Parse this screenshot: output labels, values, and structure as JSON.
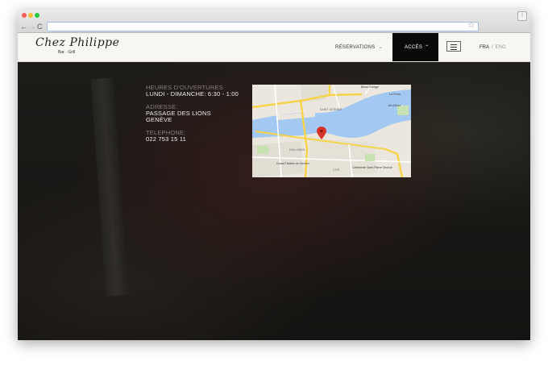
{
  "browser": {
    "address_url": "",
    "profile_glyph": "↑",
    "back_glyph": "←",
    "forward_glyph": "→",
    "reload_glyph": "C",
    "star_glyph": "☆"
  },
  "site": {
    "logo_script": "Chez Philippe",
    "logo_sub": "Bar · Grill",
    "nav": {
      "reservations": "RÉSERVATIONS",
      "acces": "ACCÈS",
      "lang_active": "FRA",
      "lang_separator": "/",
      "lang_inactive": "ENG"
    }
  },
  "info": {
    "hours_label": "HEURES D'OUVERTURES",
    "hours_value": "LUNDI - DIMANCHE: 6:30 - 1:00",
    "address_label": "ADRESSE:",
    "address_line1": "PASSAGE DES LIONS",
    "address_line2": "GENÈVE",
    "phone_label": "TELEPHONE:",
    "phone_value": "022 753 15 11"
  },
  "map": {
    "labels": {
      "beau_rivage": "Beau-Rivage",
      "la_perle": "La Perle",
      "jet_deau": "Jet d'Eau",
      "saint_gervais": "SAINT-GERVAIS",
      "grand_theatre": "Grand Théâtre de Genève",
      "cathedrale": "Cathédrale Saint-Pierre Genève",
      "hollande": "HOLLANDE",
      "cite": "CITÉ"
    }
  },
  "colors": {
    "header_bg": "#f7f6f3",
    "active_nav_bg": "#0a0a0a",
    "page_bg": "#1b1a18",
    "water": "#a3c8f2",
    "major_road": "#f5d44a",
    "marker": "#d9342b"
  }
}
